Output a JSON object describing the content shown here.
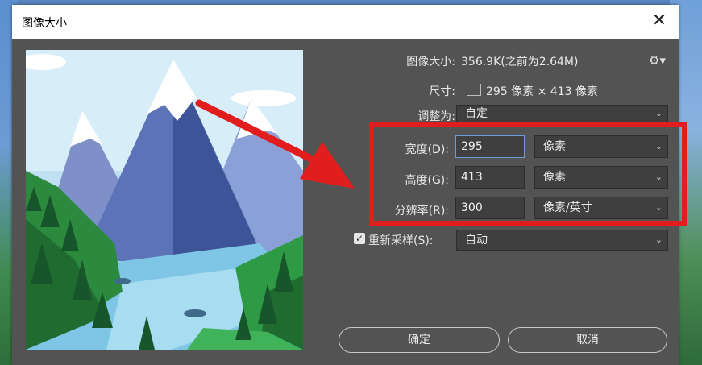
{
  "window": {
    "title": "图像大小",
    "close_glyph": "✕"
  },
  "info": {
    "image_size_label": "图像大小:",
    "image_size_value": "356.9K(之前为2.64M)",
    "dimensions_label": "尺寸:",
    "dimensions_value": "295 像素 × 413 像素"
  },
  "fit_to": {
    "label": "调整为:",
    "value": "自定"
  },
  "width": {
    "label": "宽度(D):",
    "value": "295",
    "unit": "像素"
  },
  "height": {
    "label": "高度(G):",
    "value": "413",
    "unit": "像素"
  },
  "resolution": {
    "label": "分辨率(R):",
    "value": "300",
    "unit": "像素/英寸"
  },
  "resample": {
    "checked": true,
    "label": "重新采样(S):",
    "value": "自动"
  },
  "buttons": {
    "ok": "确定",
    "cancel": "取消"
  },
  "icons": [
    "close-icon",
    "gear-icon",
    "dimension-dropdown-icon",
    "chevron-down-icon",
    "checkbox-check-icon"
  ],
  "colors": {
    "dialog_bg": "#535353",
    "annotation_red": "#e21d1d",
    "field_bg": "#3f3f3f"
  }
}
